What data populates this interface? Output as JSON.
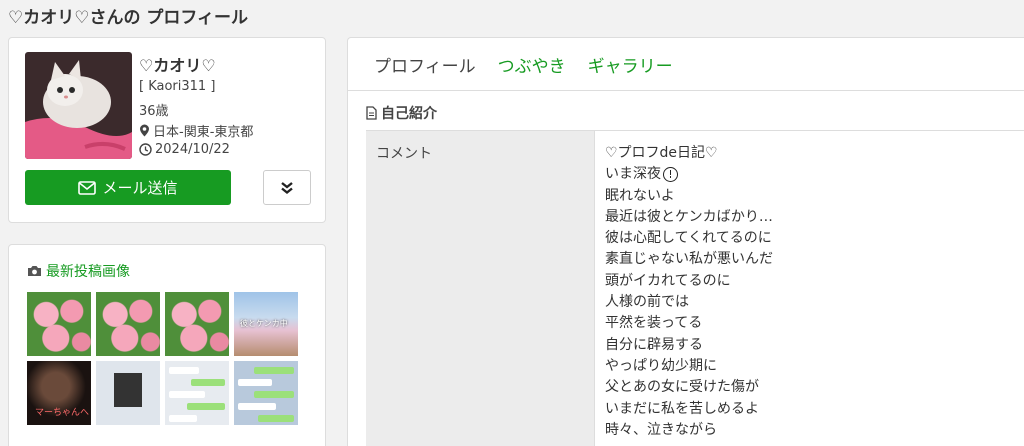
{
  "page": {
    "title": "♡カオリ♡さんの プロフィール"
  },
  "profile": {
    "name": "♡カオリ♡",
    "username": "[ Kaori311 ]",
    "age": "36歳",
    "location": "日本-関東-東京都",
    "date": "2024/10/22",
    "mail_button": "メール送信"
  },
  "images": {
    "heading": "最新投稿画像",
    "captions": {
      "blossom": "彼とケンカ中",
      "dark": "マーちゃんへ"
    }
  },
  "tabs": [
    "プロフィール",
    "つぶやき",
    "ギャラリー"
  ],
  "intro": {
    "heading": "自己紹介",
    "label": "コメント",
    "lines": [
      "♡プロフde日記♡",
      "いま深夜",
      "眠れないよ",
      "最近は彼とケンカばかり…",
      "彼は心配してくれてるのに",
      "素直じゃない私が悪いんだ",
      "頭がイカれてるのに",
      "人様の前では",
      "平然を装ってる",
      "自分に辟易する",
      "やっぱり幼少期に",
      "父とあの女に受けた傷が",
      "いまだに私を苦しめるよ",
      "時々、泣きながら"
    ]
  },
  "colors": {
    "accent": "#179b22",
    "background": "#f2f2f2"
  }
}
